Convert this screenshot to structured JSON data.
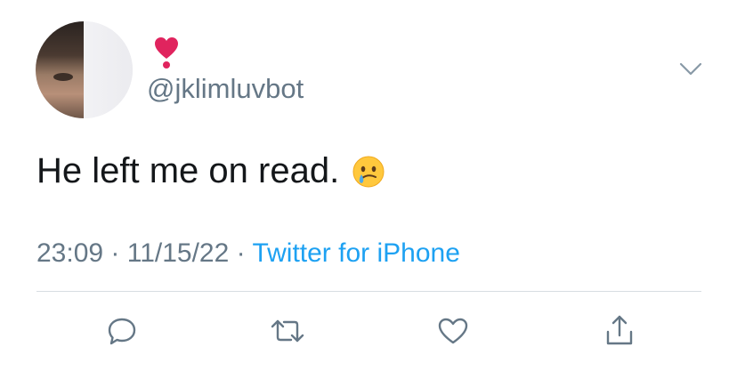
{
  "tweet": {
    "avatar_icon": "user-avatar",
    "display_name_emoji": "heavy-heart-exclamation",
    "handle": "@jklimluvbot",
    "text": "He left me on read.",
    "text_emoji": "face-holding-back-tears",
    "time": "23:09",
    "separator": " · ",
    "date": "11/15/22",
    "source": "Twitter for iPhone"
  },
  "actions": [
    {
      "icon": "reply-icon"
    },
    {
      "icon": "retweet-icon"
    },
    {
      "icon": "like-icon"
    },
    {
      "icon": "share-icon"
    }
  ],
  "colors": {
    "text": "#14171a",
    "secondary": "#657786",
    "accent": "#1da1f2",
    "divider": "#d7dde2",
    "heart": "#e0245e"
  }
}
